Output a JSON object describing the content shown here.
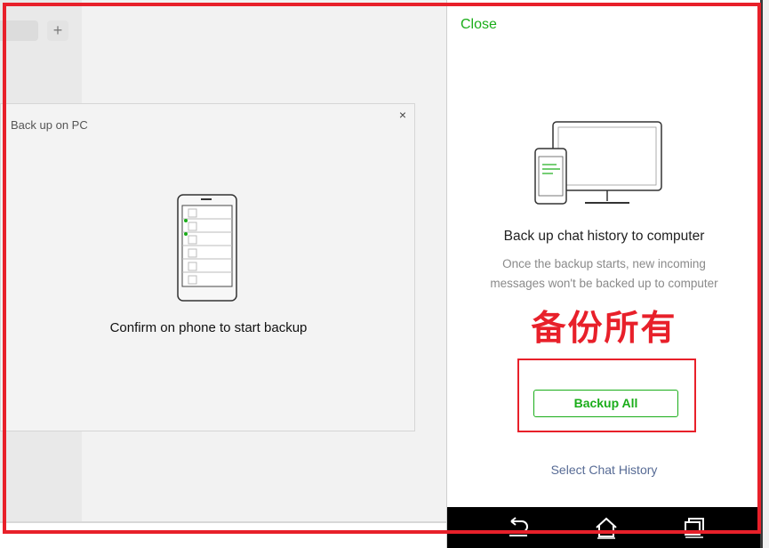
{
  "desktop": {
    "add_tab_label": "+",
    "dialog": {
      "title": "Back up on PC",
      "close_label": "×",
      "confirm_text": "Confirm on phone to start backup"
    }
  },
  "mobile": {
    "close_label": "Close",
    "headline": "Back up chat history to computer",
    "subtext_line1": "Once the backup starts, new incoming",
    "subtext_line2": "messages won't be backed up to computer",
    "annotation_cn": "备份所有",
    "backup_all_label": "Backup All",
    "select_history_label": "Select Chat History",
    "nav_icons": [
      "back-icon",
      "home-icon",
      "recents-icon"
    ]
  },
  "colors": {
    "accent_green": "#1aad19",
    "annotation_red": "#e8202a",
    "link_blue": "#576b95"
  }
}
